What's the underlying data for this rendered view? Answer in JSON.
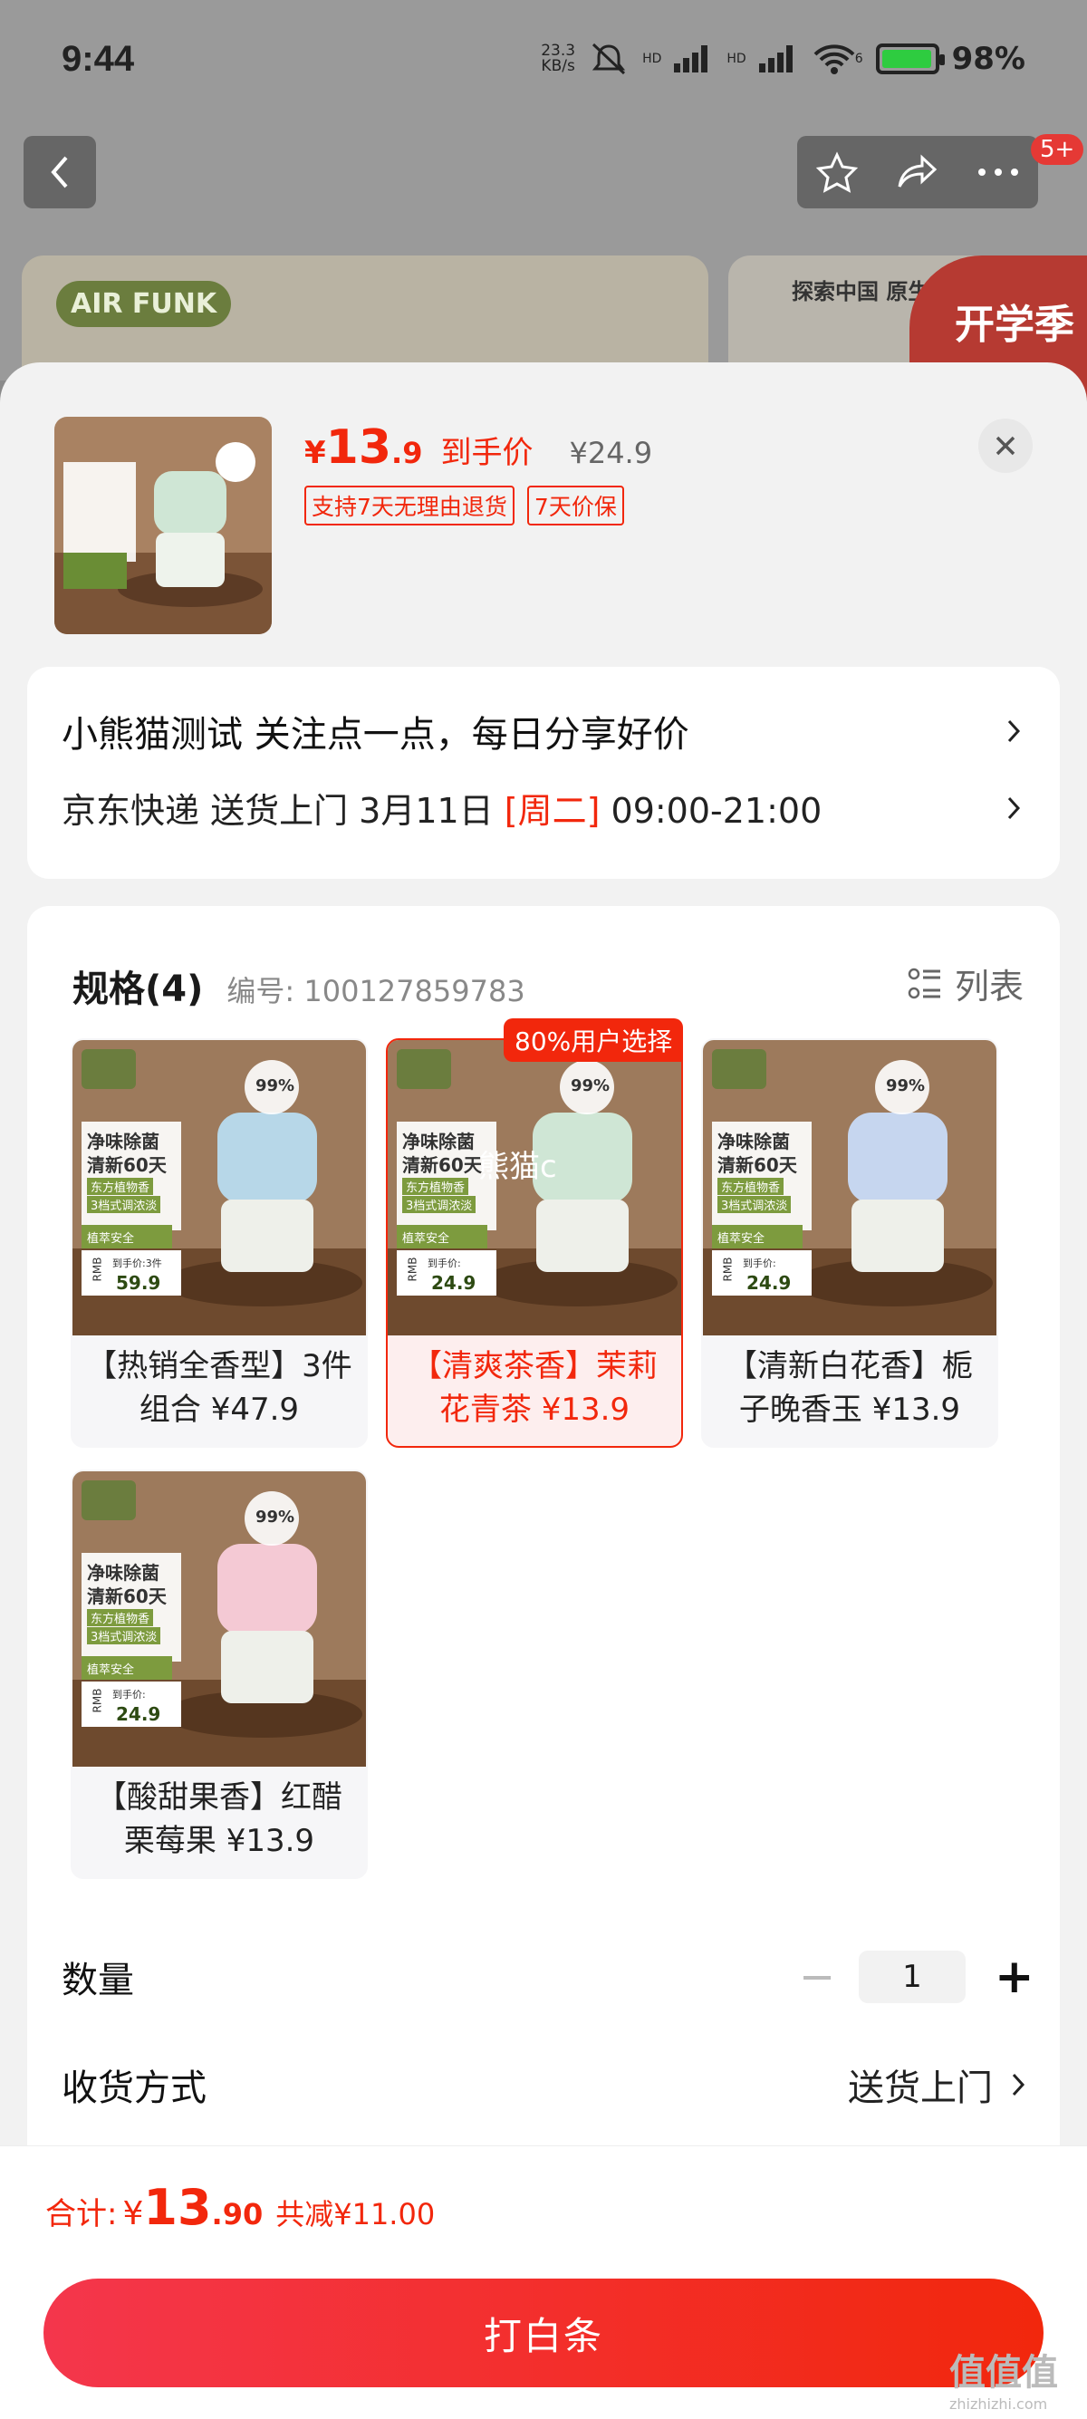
{
  "status_bar": {
    "time": "9:44",
    "speed_value": "23.3",
    "speed_unit": "KB/s",
    "network_1": "HD",
    "network_2": "HD",
    "wifi_sub": "6",
    "battery_percent": "98%"
  },
  "background": {
    "notification_badge": "5+",
    "banner_left_logo": "AIR FUNK",
    "banner_right_title": "探索中国 原生",
    "banner_right_brand": "开学季"
  },
  "product": {
    "price_symbol": "¥",
    "price_int": "13",
    "price_dec": ".9",
    "price_label": "到手价",
    "original_price": "¥24.9",
    "tags": [
      "支持7天无理由退货",
      "7天价保"
    ],
    "thumb_text": {
      "headline": "净味除菌",
      "sub": "清新60天",
      "badge": "99%",
      "price_label": "到手价",
      "price": "24.9"
    }
  },
  "address": {
    "line1": "小熊猫测试  关注点一点，每日分享好价",
    "delivery_prefix": "京东快递 送货上门 3月11日 ",
    "delivery_weekday": "[周二]",
    "delivery_time": " 09:00-21:00"
  },
  "spec": {
    "title": "规格(4)",
    "code": "编号: 100127859783",
    "list_label": "列表",
    "selected_badge": "80%用户选择",
    "options": [
      {
        "label": "【热销全香型】3件组合 ¥47.9",
        "img_price": "59.9",
        "img_price_label": "到手价:3件",
        "selected": false,
        "color": "#b7d7e8"
      },
      {
        "label": "【清爽茶香】茉莉花青茶 ¥13.9",
        "img_price": "24.9",
        "img_price_label": "到手价:",
        "selected": true,
        "color": "#cfe6d5"
      },
      {
        "label": "【清新白花香】栀子晚香玉 ¥13.9",
        "img_price": "24.9",
        "img_price_label": "到手价:",
        "selected": false,
        "color": "#c6d6ef"
      },
      {
        "label": "【酸甜果香】红醋栗莓果 ¥13.9",
        "img_price": "24.9",
        "img_price_label": "到手价:",
        "selected": false,
        "color": "#f4c9d4"
      }
    ],
    "img_overlay": {
      "headline": "净味除菌",
      "sub": "清新60天",
      "line1": "东方植物香",
      "line2": "3档式调浓淡",
      "line3": "植萃安全",
      "badge": "99%",
      "rmb": "RMB"
    },
    "watermark_text": "熊猫c"
  },
  "quantity": {
    "label": "数量",
    "value": "1",
    "minus": "−",
    "plus": "+"
  },
  "shipping": {
    "label": "收货方式",
    "value": "送货上门"
  },
  "footer": {
    "total_label": "合计:",
    "symbol": "¥",
    "int": "13",
    "dec": ".90",
    "discount": "共减¥11.00",
    "pay_button": "打白条"
  },
  "watermark": {
    "main": "值值值",
    "sub": "zhizhizhi.com"
  },
  "colors": {
    "accent": "#f2270c",
    "sheet_bg": "#f2f2f2"
  }
}
